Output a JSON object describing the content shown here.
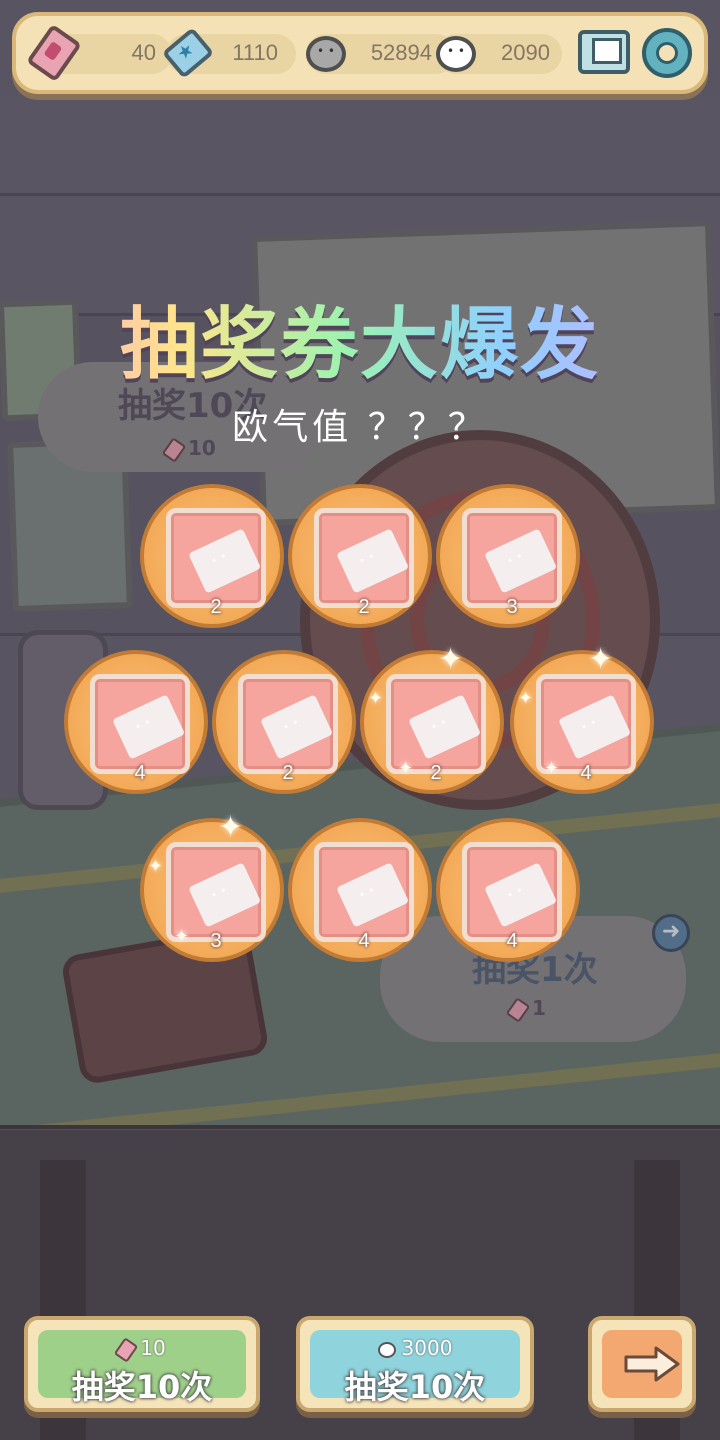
{
  "resources": [
    {
      "icon": "pink-ticket-icon",
      "value": "40"
    },
    {
      "icon": "blue-ticket-icon",
      "value": "1110"
    },
    {
      "icon": "dark-bubble-icon",
      "value": "52894"
    },
    {
      "icon": "light-bubble-icon",
      "value": "2090"
    }
  ],
  "header_icons": [
    "mail-icon",
    "gear-icon"
  ],
  "popup": {
    "title": "抽奖券大爆发",
    "subtitle": "欧气值 ？？？"
  },
  "rewards": [
    {
      "count": "2",
      "sparkle": false
    },
    {
      "count": "2",
      "sparkle": false
    },
    {
      "count": "3",
      "sparkle": false
    },
    {
      "count": "4",
      "sparkle": false
    },
    {
      "count": "2",
      "sparkle": false
    },
    {
      "count": "2",
      "sparkle": true
    },
    {
      "count": "4",
      "sparkle": true
    },
    {
      "count": "3",
      "sparkle": true
    },
    {
      "count": "4",
      "sparkle": false
    },
    {
      "count": "4",
      "sparkle": false
    }
  ],
  "background": {
    "draw10_label": "抽奖10次",
    "draw10_cost": "10",
    "draw1_label": "抽奖1次",
    "draw1_cost": "1"
  },
  "buttons": {
    "draw_ticket": {
      "cost": "10",
      "label": "抽奖10次",
      "color": "#9fd08a"
    },
    "draw_bubble": {
      "cost": "3000",
      "label": "抽奖10次",
      "color": "#8fd3dc"
    },
    "next": {
      "icon": "arrow-right-icon",
      "color": "#f3a872"
    }
  }
}
